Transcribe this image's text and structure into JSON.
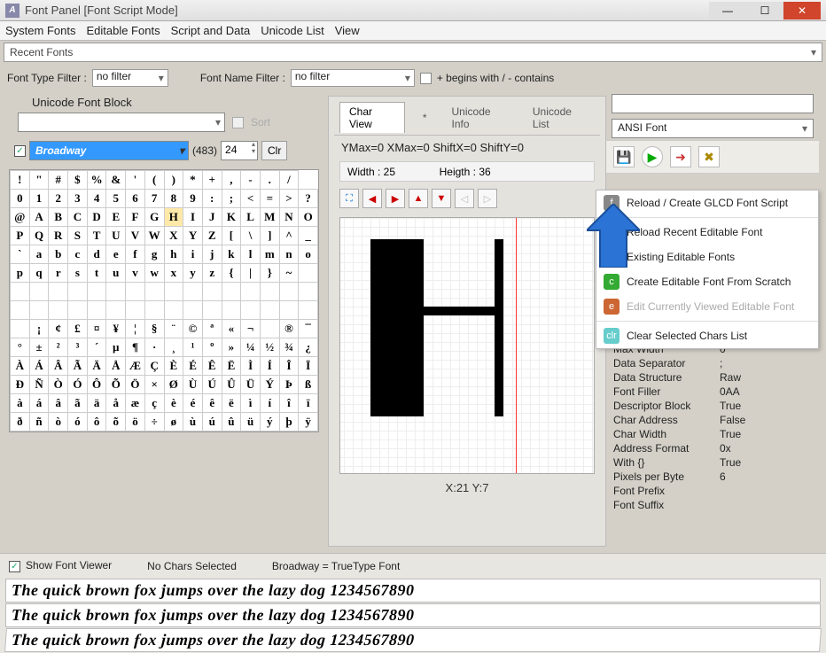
{
  "window": {
    "title": "Font Panel [Font Script Mode]"
  },
  "menubar": [
    "System Fonts",
    "Editable Fonts",
    "Script and Data",
    "Unicode List",
    "View"
  ],
  "recent": "Recent Fonts",
  "filters": {
    "type_label": "Font Type Filter :",
    "type_value": "no filter",
    "name_label": "Font Name Filter :",
    "name_value": "no filter",
    "begins_label": "+ begins with / - contains"
  },
  "unicode_block": {
    "label": "Unicode Font Block",
    "sort": "Sort"
  },
  "font_picker": {
    "name": "Broadway",
    "count": "(483)",
    "size": "24",
    "clr": "Clr"
  },
  "glyph_rows": [
    [
      "!",
      "\"",
      "#",
      "$",
      "%",
      "&",
      "'",
      "(",
      ")",
      "*",
      "+",
      ",",
      "-",
      ".",
      "/"
    ],
    [
      "0",
      "1",
      "2",
      "3",
      "4",
      "5",
      "6",
      "7",
      "8",
      "9",
      ":",
      ";",
      "<",
      "=",
      ">",
      "?"
    ],
    [
      "@",
      "A",
      "B",
      "C",
      "D",
      "E",
      "F",
      "G",
      "H",
      "I",
      "J",
      "K",
      "L",
      "M",
      "N",
      "O"
    ],
    [
      "P",
      "Q",
      "R",
      "S",
      "T",
      "U",
      "V",
      "W",
      "X",
      "Y",
      "Z",
      "[",
      "\\",
      "]",
      "^",
      "_"
    ],
    [
      "`",
      "a",
      "b",
      "c",
      "d",
      "e",
      "f",
      "g",
      "h",
      "i",
      "j",
      "k",
      "l",
      "m",
      "n",
      "o"
    ],
    [
      "p",
      "q",
      "r",
      "s",
      "t",
      "u",
      "v",
      "w",
      "x",
      "y",
      "z",
      "{",
      "|",
      "}",
      "~",
      ""
    ],
    [
      "",
      "",
      "",
      "",
      "",
      "",
      "",
      "",
      "",
      "",
      "",
      "",
      "",
      "",
      "",
      ""
    ],
    [
      "",
      "",
      "",
      "",
      "",
      "",
      "",
      "",
      "",
      "",
      "",
      "",
      "",
      "",
      "",
      ""
    ],
    [
      "",
      "¡",
      "¢",
      "£",
      "¤",
      "¥",
      "¦",
      "§",
      "¨",
      "©",
      "ª",
      "«",
      "¬",
      "",
      "®",
      "¯"
    ],
    [
      "°",
      "±",
      "²",
      "³",
      "´",
      "µ",
      "¶",
      "·",
      "¸",
      "¹",
      "º",
      "»",
      "¼",
      "½",
      "¾",
      "¿"
    ],
    [
      "À",
      "Á",
      "Â",
      "Ã",
      "Ä",
      "Å",
      "Æ",
      "Ç",
      "È",
      "É",
      "Ê",
      "Ë",
      "Ì",
      "Í",
      "Î",
      "Ï"
    ],
    [
      "Ð",
      "Ñ",
      "Ò",
      "Ó",
      "Ô",
      "Õ",
      "Ö",
      "×",
      "Ø",
      "Ù",
      "Ú",
      "Û",
      "Ü",
      "Ý",
      "Þ",
      "ß"
    ],
    [
      "à",
      "á",
      "â",
      "ã",
      "ä",
      "å",
      "æ",
      "ç",
      "è",
      "é",
      "ê",
      "ë",
      "ì",
      "í",
      "î",
      "ï"
    ],
    [
      "ð",
      "ñ",
      "ò",
      "ó",
      "ô",
      "õ",
      "ö",
      "÷",
      "ø",
      "ù",
      "ú",
      "û",
      "ü",
      "ý",
      "þ",
      "ÿ"
    ]
  ],
  "center": {
    "tabs": {
      "char_view": "Char View",
      "star": "*",
      "unicode_info": "Unicode Info",
      "unicode_list": "Unicode List"
    },
    "metrics": "YMax=0  XMax=0  ShiftX=0  ShiftY=0",
    "width_label": "Width : 25",
    "height_label": "Heigth : 36",
    "coord": "X:21 Y:7"
  },
  "right": {
    "font_select": "ANSI Font",
    "actions": [
      {
        "icon": "f",
        "label": "Reload / Create GLCD Font Script",
        "disabled": false
      },
      {
        "icon": "r",
        "label": "Reload Recent Editable Font",
        "disabled": false
      },
      {
        "icon": "e",
        "label": "Existing Editable Fonts",
        "disabled": false
      },
      {
        "icon": "c",
        "label": "Create Editable Font From Scratch",
        "disabled": false
      },
      {
        "icon": "ed",
        "label": "Edit Currently Viewed Editable Font",
        "disabled": true
      },
      {
        "icon": "clr",
        "label": "Clear Selected Chars List",
        "disabled": false
      }
    ],
    "props": [
      [
        "Max Width",
        "0"
      ],
      [
        "Data Separator",
        ";"
      ],
      [
        "Data Structure",
        "Raw"
      ],
      [
        "Font Filler",
        "0AA"
      ],
      [
        "Descriptor Block",
        "True"
      ],
      [
        "Char Address",
        "False"
      ],
      [
        "Char Width",
        "True"
      ],
      [
        "Address Format",
        "0x"
      ],
      [
        "With {}",
        "True"
      ],
      [
        "Pixels per Byte",
        "6"
      ],
      [
        "Font Prefix",
        ""
      ],
      [
        "Font Suffix",
        ""
      ]
    ]
  },
  "bottom": {
    "show_viewer": "Show Font Viewer",
    "no_chars": "No Chars Selected",
    "font_type": "Broadway = TrueType Font",
    "sample": "The quick brown fox jumps over the lazy dog 1234567890"
  }
}
